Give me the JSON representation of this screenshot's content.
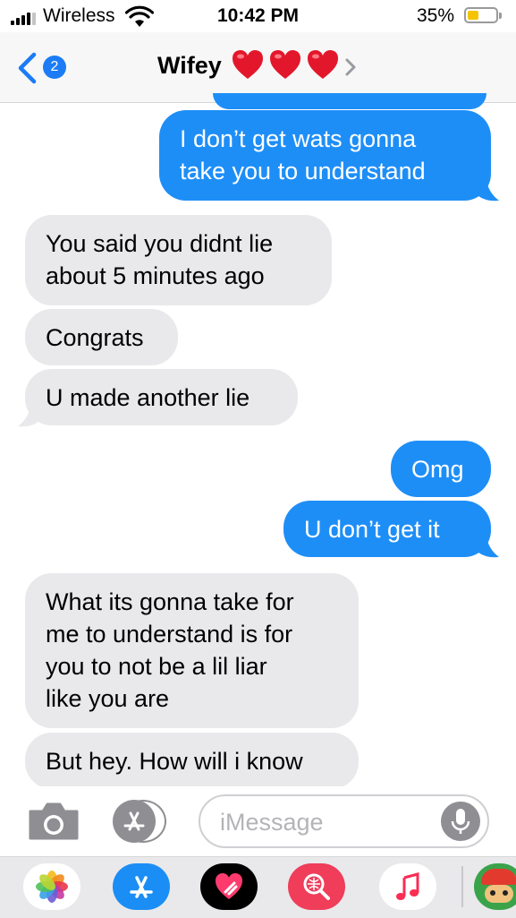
{
  "status_bar": {
    "carrier": "Wireless",
    "time": "10:42 PM",
    "battery_percent": "35%",
    "battery_level": 0.35
  },
  "nav": {
    "back_badge": "2",
    "contact_name": "Wifey",
    "contact_emoji": [
      "heart-icon",
      "heart-icon",
      "heart-icon"
    ]
  },
  "messages": [
    {
      "direction": "outgoing",
      "lines": [
        "I don’t get wats gonna",
        "take you to understand"
      ]
    },
    {
      "direction": "incoming",
      "lines": [
        "You said you didnt lie",
        "about 5 minutes ago"
      ]
    },
    {
      "direction": "incoming",
      "lines": [
        "Congrats"
      ]
    },
    {
      "direction": "incoming",
      "lines": [
        "U made another lie"
      ]
    },
    {
      "direction": "outgoing",
      "lines": [
        "Omg"
      ]
    },
    {
      "direction": "outgoing",
      "lines": [
        "U don’t get it"
      ]
    },
    {
      "direction": "incoming",
      "lines": [
        "What its gonna take for",
        "me to understand is for",
        "you to not be a lil liar",
        "like you are"
      ]
    },
    {
      "direction": "incoming",
      "lines": [
        "But hey. How will i know"
      ]
    }
  ],
  "composer": {
    "placeholder": "iMessage"
  },
  "app_drawer": {
    "apps": [
      "photos-app-icon",
      "app-store-icon",
      "digital-touch-icon",
      "web-images-icon",
      "music-app-icon",
      "game-app-icon"
    ]
  },
  "colors": {
    "outgoing_bubble": "#1e8ef7",
    "incoming_bubble": "#e9e9ec",
    "ios_blue": "#1b7cf5",
    "battery_low": "#f5c400"
  }
}
